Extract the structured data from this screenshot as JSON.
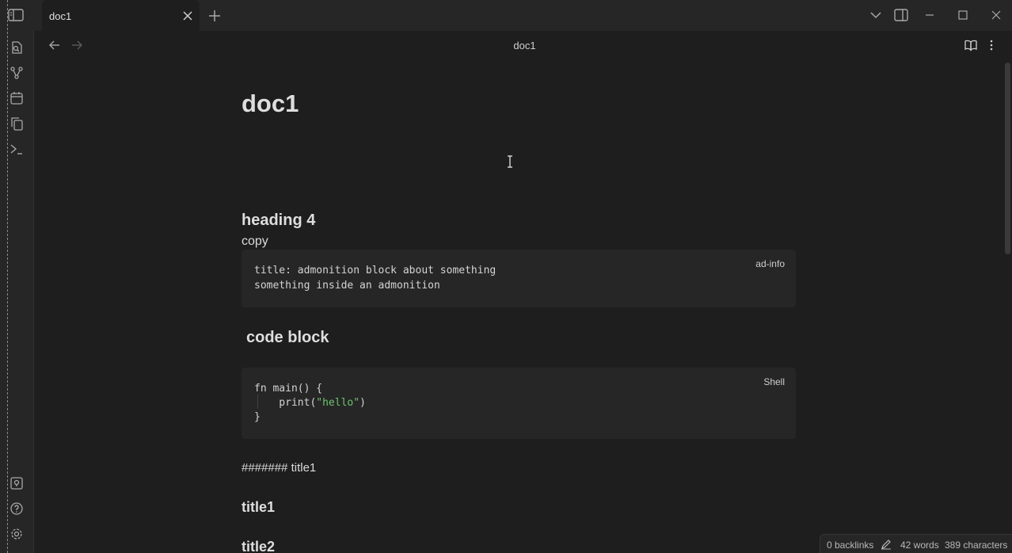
{
  "tab": {
    "title": "doc1"
  },
  "view": {
    "title": "doc1"
  },
  "document": {
    "h1": "doc1",
    "heading4": "heading 4",
    "paragraph": "copy",
    "admonition": {
      "lang": "ad-info",
      "lines": [
        "title: admonition block about something",
        "something inside an admonition"
      ]
    },
    "code_heading": "code block",
    "code": {
      "lang": "Shell",
      "line1": "fn main() {",
      "line2_pre": "    print(",
      "line2_str": "\"hello\"",
      "line2_post": ")",
      "line3": "}"
    },
    "hash_line": "####### title1",
    "title1": "title1",
    "title2": "title2"
  },
  "status": {
    "backlinks": "0 backlinks",
    "words": "42 words",
    "characters": "389 characters"
  },
  "colors": {
    "background": "#1e1e1e",
    "chrome": "#262626",
    "string": "#6ec36e"
  }
}
